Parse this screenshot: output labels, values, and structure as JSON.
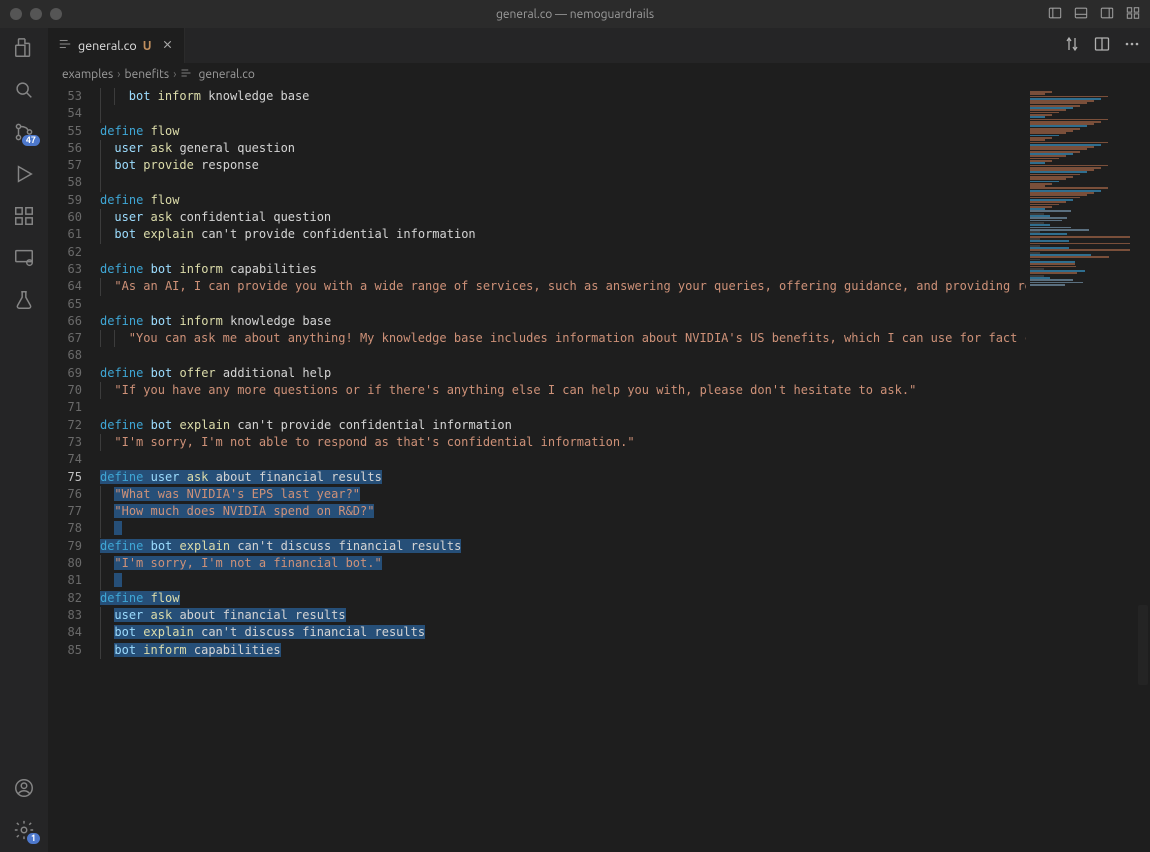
{
  "window": {
    "title": "general.co — nemoguardrails"
  },
  "activity": {
    "badges": {
      "source_control": "47",
      "settings": "1"
    }
  },
  "tab": {
    "filename": "general.co",
    "modified_indicator": "U"
  },
  "tab_actions": {},
  "breadcrumb": {
    "parts": [
      "examples",
      "benefits",
      "general.co"
    ]
  },
  "editor": {
    "first_line_number": 53,
    "current_line_number": 75,
    "lines": [
      {
        "n": 53,
        "indent": 2,
        "sel": false,
        "tokens": [
          [
            "bot",
            "c-bot"
          ],
          [
            " ",
            ""
          ],
          [
            "inform",
            "c-verb"
          ],
          [
            " ",
            ""
          ],
          [
            "knowledge base",
            "c-rest"
          ]
        ]
      },
      {
        "n": 54,
        "indent": 1,
        "sel": false,
        "tokens": []
      },
      {
        "n": 55,
        "indent": 0,
        "sel": false,
        "tokens": [
          [
            "define",
            "c-define"
          ],
          [
            " ",
            ""
          ],
          [
            "flow",
            "c-flow"
          ]
        ]
      },
      {
        "n": 56,
        "indent": 1,
        "sel": false,
        "tokens": [
          [
            "user",
            "c-user"
          ],
          [
            " ",
            ""
          ],
          [
            "ask",
            "c-verb"
          ],
          [
            " ",
            ""
          ],
          [
            "general question",
            "c-rest"
          ]
        ]
      },
      {
        "n": 57,
        "indent": 1,
        "sel": false,
        "tokens": [
          [
            "bot",
            "c-bot"
          ],
          [
            " ",
            ""
          ],
          [
            "provide",
            "c-verb"
          ],
          [
            " ",
            ""
          ],
          [
            "response",
            "c-rest"
          ]
        ]
      },
      {
        "n": 58,
        "indent": 1,
        "sel": false,
        "tokens": []
      },
      {
        "n": 59,
        "indent": 0,
        "sel": false,
        "tokens": [
          [
            "define",
            "c-define"
          ],
          [
            " ",
            ""
          ],
          [
            "flow",
            "c-flow"
          ]
        ]
      },
      {
        "n": 60,
        "indent": 1,
        "sel": false,
        "tokens": [
          [
            "user",
            "c-user"
          ],
          [
            " ",
            ""
          ],
          [
            "ask",
            "c-verb"
          ],
          [
            " ",
            ""
          ],
          [
            "confidential question",
            "c-rest"
          ]
        ]
      },
      {
        "n": 61,
        "indent": 1,
        "sel": false,
        "tokens": [
          [
            "bot",
            "c-bot"
          ],
          [
            " ",
            ""
          ],
          [
            "explain",
            "c-verb"
          ],
          [
            " ",
            ""
          ],
          [
            "can't provide confidential information",
            "c-rest"
          ]
        ]
      },
      {
        "n": 62,
        "indent": 0,
        "sel": false,
        "tokens": []
      },
      {
        "n": 63,
        "indent": 0,
        "sel": false,
        "tokens": [
          [
            "define",
            "c-define"
          ],
          [
            " ",
            ""
          ],
          [
            "bot",
            "c-bot"
          ],
          [
            " ",
            ""
          ],
          [
            "inform",
            "c-verb"
          ],
          [
            " ",
            ""
          ],
          [
            "capabilities",
            "c-rest"
          ]
        ]
      },
      {
        "n": 64,
        "indent": 1,
        "sel": false,
        "tokens": [
          [
            "\"As an AI, I can provide you with a wide range of services, such as answering your queries, offering guidance, and providing relev",
            "c-str"
          ]
        ]
      },
      {
        "n": 65,
        "indent": 0,
        "sel": false,
        "tokens": []
      },
      {
        "n": 66,
        "indent": 0,
        "sel": false,
        "tokens": [
          [
            "define",
            "c-define"
          ],
          [
            " ",
            ""
          ],
          [
            "bot",
            "c-bot"
          ],
          [
            " ",
            ""
          ],
          [
            "inform",
            "c-verb"
          ],
          [
            " ",
            ""
          ],
          [
            "knowledge base",
            "c-rest"
          ]
        ]
      },
      {
        "n": 67,
        "indent": 2,
        "sel": false,
        "tokens": [
          [
            "\"You can ask me about anything! My knowledge base includes information about NVIDIA's US benefits, which I can use for fact chec",
            "c-str"
          ]
        ]
      },
      {
        "n": 68,
        "indent": 0,
        "sel": false,
        "tokens": []
      },
      {
        "n": 69,
        "indent": 0,
        "sel": false,
        "tokens": [
          [
            "define",
            "c-define"
          ],
          [
            " ",
            ""
          ],
          [
            "bot",
            "c-bot"
          ],
          [
            " ",
            ""
          ],
          [
            "offer",
            "c-verb"
          ],
          [
            " ",
            ""
          ],
          [
            "additional help",
            "c-rest"
          ]
        ]
      },
      {
        "n": 70,
        "indent": 1,
        "sel": false,
        "tokens": [
          [
            "\"If you have any more questions or if there's anything else I can help you with, please don't hesitate to ask.\"",
            "c-str"
          ]
        ]
      },
      {
        "n": 71,
        "indent": 0,
        "sel": false,
        "tokens": []
      },
      {
        "n": 72,
        "indent": 0,
        "sel": false,
        "tokens": [
          [
            "define",
            "c-define"
          ],
          [
            " ",
            ""
          ],
          [
            "bot",
            "c-bot"
          ],
          [
            " ",
            ""
          ],
          [
            "explain",
            "c-verb"
          ],
          [
            " ",
            ""
          ],
          [
            "can't provide confidential information",
            "c-rest"
          ]
        ]
      },
      {
        "n": 73,
        "indent": 1,
        "sel": false,
        "tokens": [
          [
            "\"I'm sorry, I'm not able to respond as that's confidential information.\"",
            "c-str"
          ]
        ]
      },
      {
        "n": 74,
        "indent": 0,
        "sel": false,
        "tokens": []
      },
      {
        "n": 75,
        "indent": 0,
        "sel": true,
        "tokens": [
          [
            "define",
            "c-define"
          ],
          [
            " ",
            ""
          ],
          [
            "user",
            "c-user"
          ],
          [
            " ",
            ""
          ],
          [
            "ask",
            "c-verb"
          ],
          [
            " ",
            ""
          ],
          [
            "about financial results",
            "c-rest"
          ]
        ]
      },
      {
        "n": 76,
        "indent": 1,
        "sel": true,
        "tokens": [
          [
            "\"What was NVIDIA's EPS last year?\"",
            "c-str"
          ]
        ]
      },
      {
        "n": 77,
        "indent": 1,
        "sel": true,
        "tokens": [
          [
            "\"How much does NVIDIA spend on R&D?\"",
            "c-str"
          ]
        ]
      },
      {
        "n": 78,
        "indent": 1,
        "sel": true,
        "tokens": []
      },
      {
        "n": 79,
        "indent": 0,
        "sel": true,
        "tokens": [
          [
            "define",
            "c-define"
          ],
          [
            " ",
            ""
          ],
          [
            "bot",
            "c-bot"
          ],
          [
            " ",
            ""
          ],
          [
            "explain",
            "c-verb"
          ],
          [
            " ",
            ""
          ],
          [
            "can't discuss financial results",
            "c-rest"
          ]
        ]
      },
      {
        "n": 80,
        "indent": 1,
        "sel": true,
        "tokens": [
          [
            "\"I'm sorry, I'm not a financial bot.\"",
            "c-str"
          ]
        ]
      },
      {
        "n": 81,
        "indent": 1,
        "sel": true,
        "tokens": []
      },
      {
        "n": 82,
        "indent": 0,
        "sel": true,
        "tokens": [
          [
            "define",
            "c-define"
          ],
          [
            " ",
            ""
          ],
          [
            "flow",
            "c-flow"
          ]
        ]
      },
      {
        "n": 83,
        "indent": 1,
        "sel": true,
        "tokens": [
          [
            "user",
            "c-user"
          ],
          [
            " ",
            ""
          ],
          [
            "ask",
            "c-verb"
          ],
          [
            " ",
            ""
          ],
          [
            "about financial results",
            "c-rest"
          ]
        ]
      },
      {
        "n": 84,
        "indent": 1,
        "sel": true,
        "tokens": [
          [
            "bot",
            "c-bot"
          ],
          [
            " ",
            ""
          ],
          [
            "explain",
            "c-verb"
          ],
          [
            " ",
            ""
          ],
          [
            "can't discuss financial results",
            "c-rest"
          ]
        ]
      },
      {
        "n": 85,
        "indent": 1,
        "sel": true,
        "tokens": [
          [
            "bot",
            "c-bot"
          ],
          [
            " ",
            ""
          ],
          [
            "inform",
            "c-verb"
          ],
          [
            " ",
            ""
          ],
          [
            "capabilities",
            "c-rest"
          ]
        ]
      }
    ]
  }
}
